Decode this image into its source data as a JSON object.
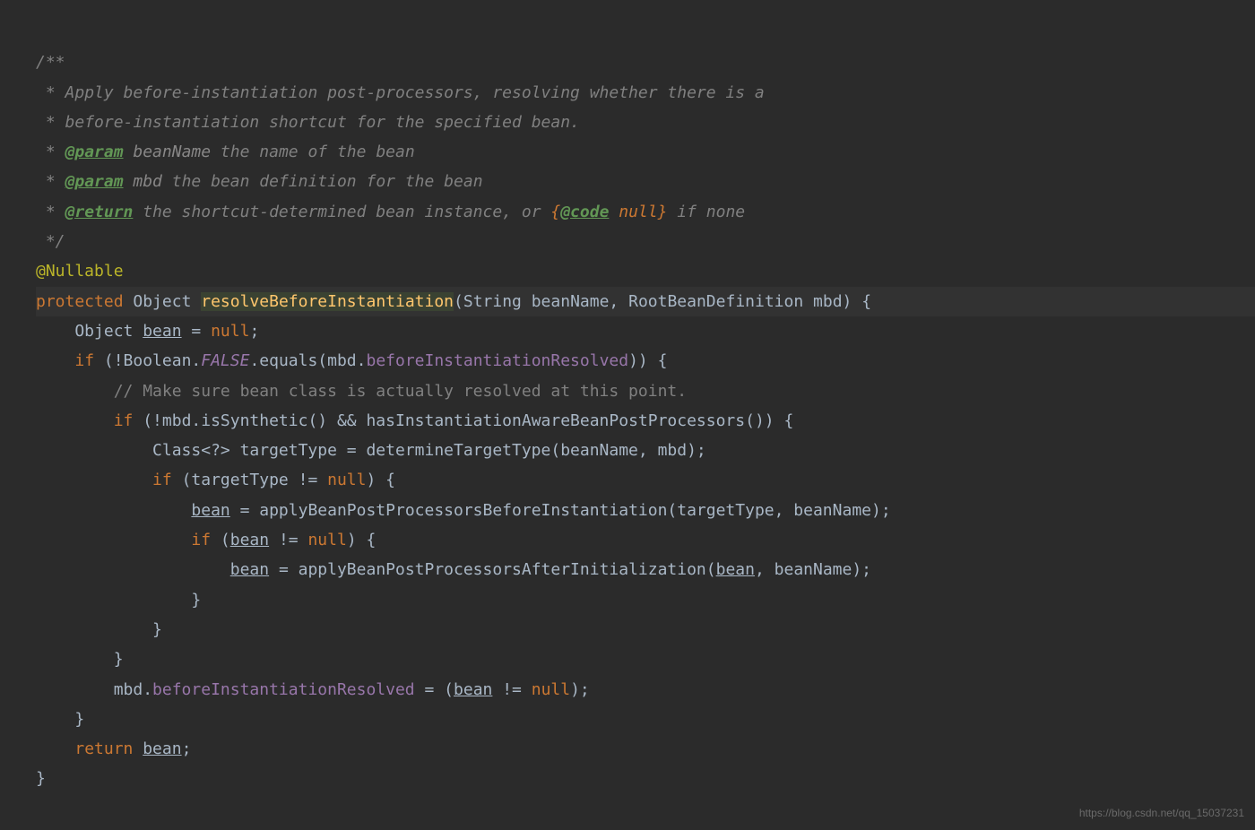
{
  "code": {
    "c1": "/**",
    "c2a": " * ",
    "c2b": "Apply before-instantiation post-processors, resolving whether there is a",
    "c3a": " * ",
    "c3b": "before-instantiation shortcut for the specified bean.",
    "c4a": " * ",
    "c4tag": "@param",
    "c4name": " beanName",
    "c4desc": " the name of the bean",
    "c5a": " * ",
    "c5tag": "@param",
    "c5name": " mbd",
    "c5desc": " the bean definition for the bean",
    "c6a": " * ",
    "c6tag": "@return",
    "c6desc": " the shortcut-determined bean instance, or ",
    "c6code_open": "{",
    "c6code_tag": "@code",
    "c6code_text": " null}",
    "c6desc2": " if none",
    "c7": " */",
    "anno": "@Nullable",
    "kw_protected": "protected",
    "type_object": " Object ",
    "method_name": "resolveBeforeInstantiation",
    "paren_open": "(",
    "type_string": "String ",
    "param1": "beanName",
    "comma1": ", ",
    "type_rbd": "RootBeanDefinition ",
    "param2": "mbd",
    "paren_close": ")",
    "brace_open": " {",
    "l1a": "    Object ",
    "l1b": "bean",
    "l1c": " = ",
    "l1d": "null",
    "l1e": ";",
    "l2a": "    ",
    "l2if": "if ",
    "l2b": "(!Boolean.",
    "l2false": "FALSE",
    "l2c": ".equals(mbd.",
    "l2field": "beforeInstantiationResolved",
    "l2d": ")) {",
    "l3a": "        ",
    "l3comment": "// Make sure bean class is actually resolved at this point.",
    "l4a": "        ",
    "l4if": "if ",
    "l4b": "(!mbd.isSynthetic() && hasInstantiationAwareBeanPostProcessors()) {",
    "l5a": "            Class<?> targetType = determineTargetType(beanName, mbd);",
    "l6a": "            ",
    "l6if": "if ",
    "l6b": "(targetType != ",
    "l6null": "null",
    "l6c": ") {",
    "l7a": "                ",
    "l7bean": "bean",
    "l7b": " = applyBeanPostProcessorsBeforeInstantiation(targetType, beanName);",
    "l8a": "                ",
    "l8if": "if ",
    "l8b": "(",
    "l8bean": "bean",
    "l8c": " != ",
    "l8null": "null",
    "l8d": ") {",
    "l9a": "                    ",
    "l9bean": "bean",
    "l9b": " = applyBeanPostProcessorsAfterInitialization(",
    "l9bean2": "bean",
    "l9c": ", beanName);",
    "l10a": "                }",
    "l11a": "            }",
    "l12a": "        }",
    "l13a": "        mbd.",
    "l13field": "beforeInstantiationResolved",
    "l13b": " = (",
    "l13bean": "bean",
    "l13c": " != ",
    "l13null": "null",
    "l13d": ");",
    "l14a": "    }",
    "l15a": "    ",
    "l15return": "return ",
    "l15bean": "bean",
    "l15b": ";",
    "l16a": "}"
  },
  "watermark": "https://blog.csdn.net/qq_15037231"
}
